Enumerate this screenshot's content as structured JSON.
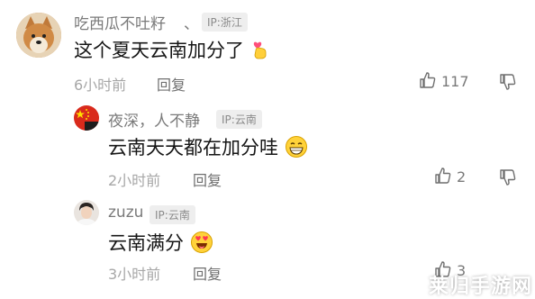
{
  "comments": [
    {
      "username": "吃西瓜不吐籽",
      "name_suffix": "、",
      "ip": "IP:浙江",
      "text": "这个夏天云南加分了",
      "time": "6小时前",
      "reply_label": "回复",
      "like_count": "117"
    },
    {
      "username": "夜深，人不静",
      "ip": "IP:云南",
      "text": "云南天天都在加分哇",
      "time": "2小时前",
      "reply_label": "回复",
      "like_count": "2"
    },
    {
      "username": "zuzu",
      "ip": "IP:云南",
      "text": "云南满分",
      "time": "3小时前",
      "reply_label": "回复",
      "like_count": "3"
    }
  ],
  "watermark": "莱归手游网",
  "icons": {
    "like": "thumbs-up-icon",
    "dislike": "thumbs-down-icon"
  },
  "colors": {
    "text_primary": "#161616",
    "text_secondary": "#7a7a7a",
    "ip_bg": "#eeeeee"
  }
}
